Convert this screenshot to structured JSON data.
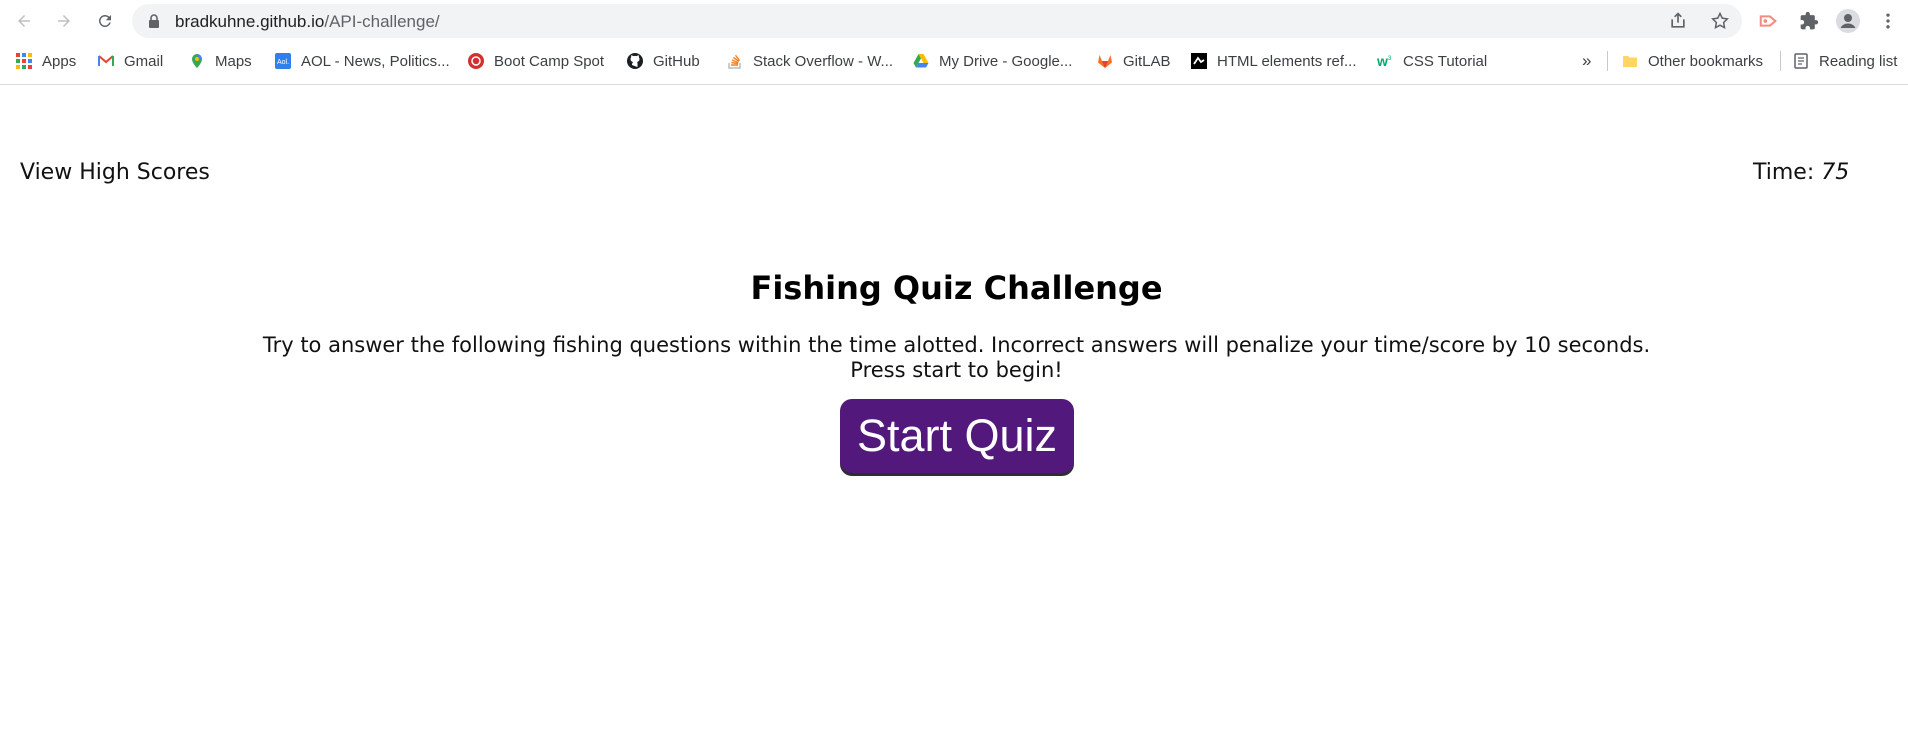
{
  "browser": {
    "url_host": "bradkuhne.github.io",
    "url_path": "/API-challenge/",
    "bookmarks": [
      {
        "label": "Apps",
        "icon": "apps-grid-icon"
      },
      {
        "label": "Gmail",
        "icon": "gmail-icon"
      },
      {
        "label": "Maps",
        "icon": "maps-pin-icon"
      },
      {
        "label": "AOL - News, Politics...",
        "icon": "aol-icon"
      },
      {
        "label": "Boot Camp Spot",
        "icon": "bootcamp-icon"
      },
      {
        "label": "GitHub",
        "icon": "github-icon"
      },
      {
        "label": "Stack Overflow - W...",
        "icon": "stackoverflow-icon"
      },
      {
        "label": "My Drive - Google...",
        "icon": "google-drive-icon"
      },
      {
        "label": "GitLAB",
        "icon": "gitlab-icon"
      },
      {
        "label": "HTML elements ref...",
        "icon": "mdn-icon"
      },
      {
        "label": "CSS Tutorial",
        "icon": "w3schools-icon"
      }
    ],
    "overflow_label": "»",
    "other_bookmarks": "Other bookmarks",
    "reading_list": "Reading list"
  },
  "header": {
    "high_scores_label": "View High Scores",
    "time_label": "Time:",
    "time_value": "75"
  },
  "main": {
    "title": "Fishing Quiz Challenge",
    "description": "Try to answer the following fishing questions within the time alotted. Incorrect answers will penalize your time/score by 10 seconds. Press start to begin!",
    "start_button": "Start Quiz"
  },
  "colors": {
    "start_button_bg": "#52187c",
    "start_button_text": "#ffffff"
  }
}
